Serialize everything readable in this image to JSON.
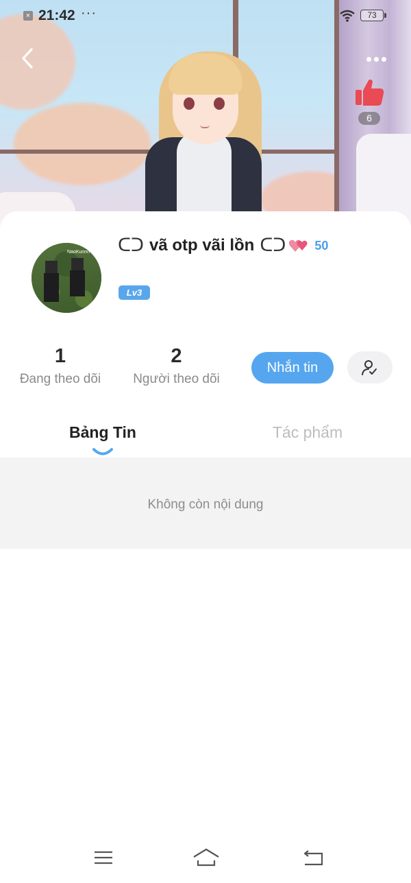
{
  "status_bar": {
    "time": "21:42",
    "dots": "···",
    "battery": "73"
  },
  "banner": {
    "like_count": "6"
  },
  "profile": {
    "name_prefix": "ᑕᑐ",
    "name": "vã otp vãi lồn",
    "name_suffix": "ᑕᑐ",
    "popularity": "50",
    "level": "Lv3",
    "avatar_tag": "NaoKunnn"
  },
  "stats": {
    "following_count": "1",
    "following_label": "Đang theo dõi",
    "followers_count": "2",
    "followers_label": "Người theo dõi"
  },
  "actions": {
    "message_label": "Nhắn tin"
  },
  "tabs": [
    {
      "label": "Bảng Tin",
      "active": true
    },
    {
      "label": "Tác phẩm",
      "active": false
    }
  ],
  "feed": {
    "empty_text": "Không còn nội dung"
  },
  "colors": {
    "accent": "#55a6ef",
    "popularity": "#4a9fe8",
    "like": "#e94a53"
  }
}
